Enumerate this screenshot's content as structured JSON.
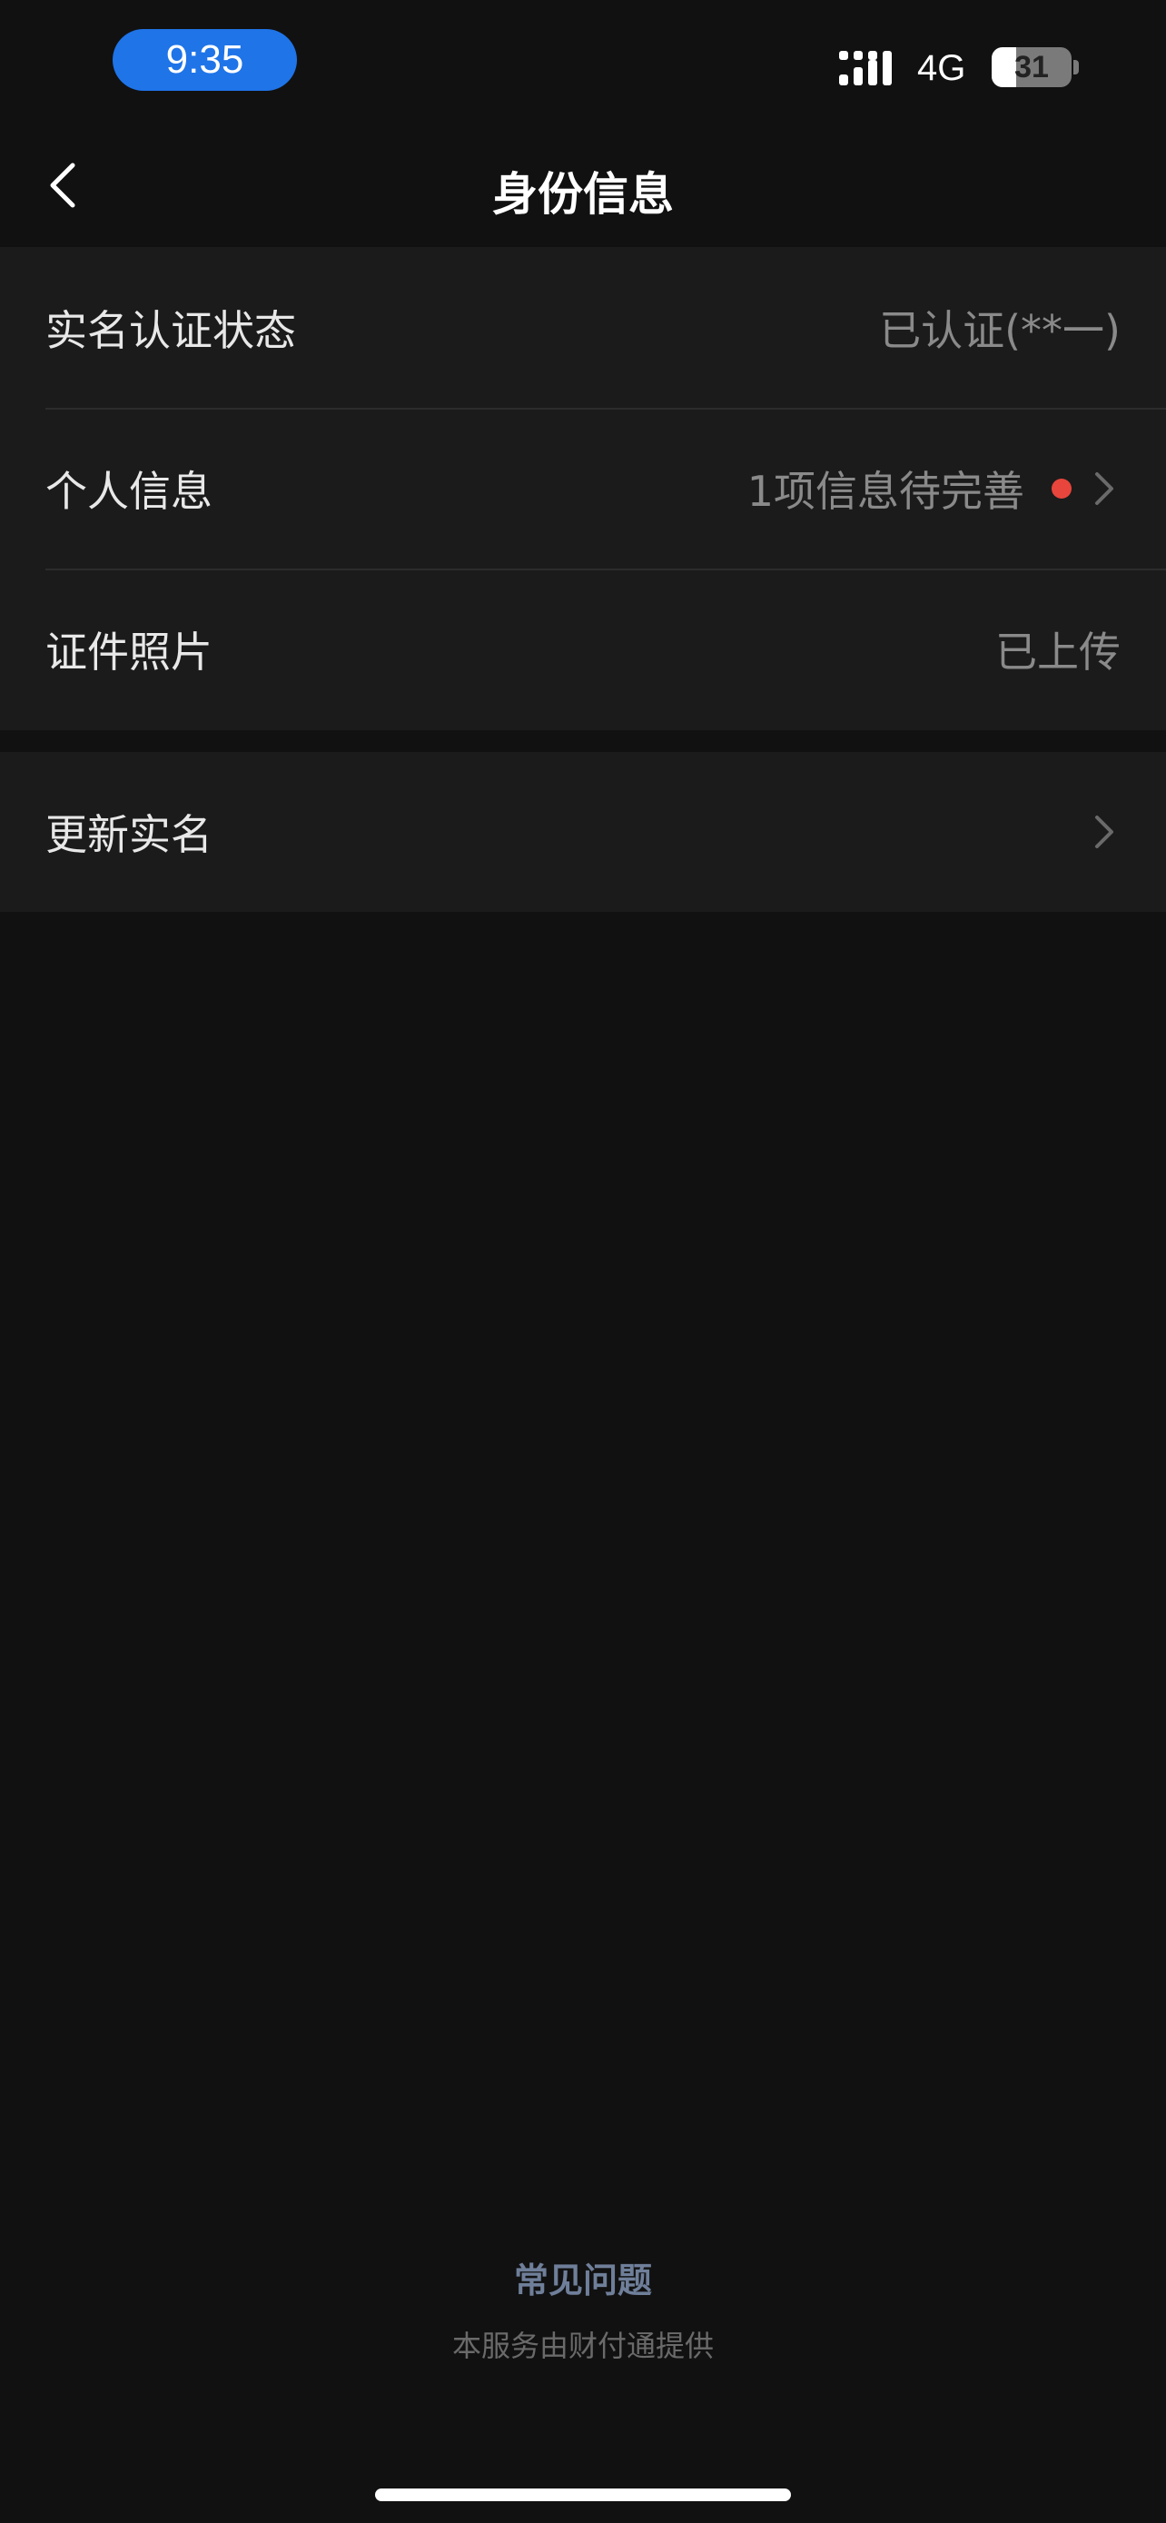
{
  "status_bar": {
    "time": "9:35",
    "network": "4G",
    "battery_level": "31",
    "battery_fraction": 0.31,
    "time_pill_color": "#1f74e8"
  },
  "nav": {
    "title": "身份信息",
    "back_icon": "chevron-left-icon"
  },
  "identity_rows": [
    {
      "label": "实名认证状态",
      "value": "已认证(**一)"
    },
    {
      "label": "个人信息",
      "value": "1项信息待完善"
    },
    {
      "label": "证件照片",
      "value": "已上传"
    }
  ],
  "update_row": {
    "label": "更新实名"
  },
  "footer": {
    "faq_link": "常见问题",
    "provider_note": "本服务由财付通提供"
  },
  "colors": {
    "background": "#111111",
    "group_background": "#1b1b1b",
    "alert_dot": "#e8453c",
    "link": "#6f7f9a"
  }
}
